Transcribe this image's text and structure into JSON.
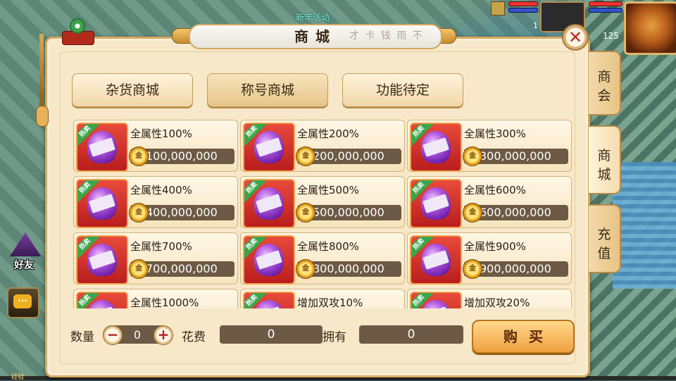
{
  "event_text": "新年活动",
  "hud": {
    "pet_level": "1",
    "hero_level": "125"
  },
  "left_buttons": {
    "friend_label": "好友",
    "chat_label": "···"
  },
  "exp_label": "经验",
  "panel": {
    "title": "商城",
    "title_deco": "才 卡 钱 雨 不",
    "close_symbol": "✕"
  },
  "tabs": [
    {
      "label": "杂货商城"
    },
    {
      "label": "称号商城"
    },
    {
      "label": "功能待定"
    }
  ],
  "side_tabs": [
    {
      "chars": [
        "商",
        "会"
      ]
    },
    {
      "chars": [
        "商",
        "城"
      ]
    },
    {
      "chars": [
        "充",
        "值"
      ]
    }
  ],
  "hot_badge": "热卖",
  "items": [
    {
      "name": "全属性100%",
      "price": "100,000,000"
    },
    {
      "name": "全属性200%",
      "price": "200,000,000"
    },
    {
      "name": "全属性300%",
      "price": "300,000,000"
    },
    {
      "name": "全属性400%",
      "price": "400,000,000"
    },
    {
      "name": "全属性500%",
      "price": "500,000,000"
    },
    {
      "name": "全属性600%",
      "price": "600,000,000"
    },
    {
      "name": "全属性700%",
      "price": "700,000,000"
    },
    {
      "name": "全属性800%",
      "price": "800,000,000"
    },
    {
      "name": "全属性900%",
      "price": "900,000,000"
    },
    {
      "name": "全属性1000%",
      "price": ""
    },
    {
      "name": "增加双攻10%",
      "price": ""
    },
    {
      "name": "增加双攻20%",
      "price": ""
    }
  ],
  "bottom": {
    "qty_label": "数量",
    "qty_value": "0",
    "qty_minus": "−",
    "qty_plus": "+",
    "cost_label": "花费",
    "cost_value": "0",
    "own_label": "拥有",
    "own_value": "0",
    "buy_label": "购买"
  }
}
